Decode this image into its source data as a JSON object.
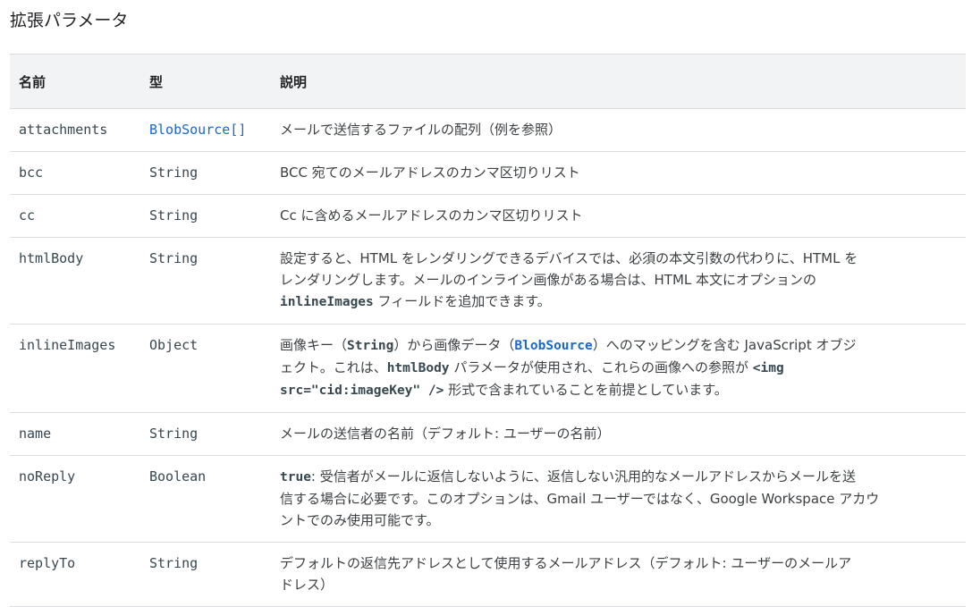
{
  "section_title": "拡張パラメータ",
  "table": {
    "headers": [
      "名前",
      "型",
      "説明"
    ],
    "rows": [
      {
        "name": "attachments",
        "type": "BlobSource[]",
        "desc": [
          "メールで送信するファイルの配列（例を参照）"
        ]
      },
      {
        "name": "bcc",
        "type": "String",
        "desc": [
          "BCC 宛てのメールアドレスのカンマ区切りリスト"
        ]
      },
      {
        "name": "cc",
        "type": "String",
        "desc": [
          "Cc に含めるメールアドレスのカンマ区切りリスト"
        ]
      },
      {
        "name": "htmlBody",
        "type": "String",
        "desc": [
          "設定すると、HTML をレンダリングできるデバイスでは、必須の本文引数の代わりに、HTML を",
          "レンダリングします。メールのインライン画像がある場合は、HTML 本文にオプションの",
          "フィールドを追加できます。"
        ],
        "desc_code": "inlineImages"
      },
      {
        "name": "inlineImages",
        "type": "Object",
        "desc_parts": {
          "l1_a": "画像キー（",
          "l1_code1": "String",
          "l1_b": "）から画像データ（",
          "l1_code2": "BlobSource",
          "l1_c": "）へのマッピングを含む JavaScript オブジ",
          "l2_a": "ェクト。これは、",
          "l2_code": "htmlBody",
          "l2_b": " パラメータが使用され、これらの画像への参照が ",
          "l2_code2": "<img",
          "l3_code": "src=\"cid:imageKey\" />",
          "l3_b": " 形式で含まれていることを前提としています。"
        }
      },
      {
        "name": "name",
        "type": "String",
        "desc": [
          "メールの送信者の名前（デフォルト: ユーザーの名前）"
        ]
      },
      {
        "name": "noReply",
        "type": "Boolean",
        "desc_parts": {
          "l1_code": "true",
          "l1_b": ": 受信者がメールに返信しないように、返信しない汎用的なメールアドレスからメールを送",
          "l2": "信する場合に必要です。このオプションは、Gmail ユーザーではなく、Google Workspace アカウ",
          "l3": "ントでのみ使用可能です。"
        }
      },
      {
        "name": "replyTo",
        "type": "String",
        "desc": [
          "デフォルトの返信先アドレスとして使用するメールアドレス（デフォルト: ユーザーのメールア",
          "ドレス）"
        ]
      }
    ]
  }
}
